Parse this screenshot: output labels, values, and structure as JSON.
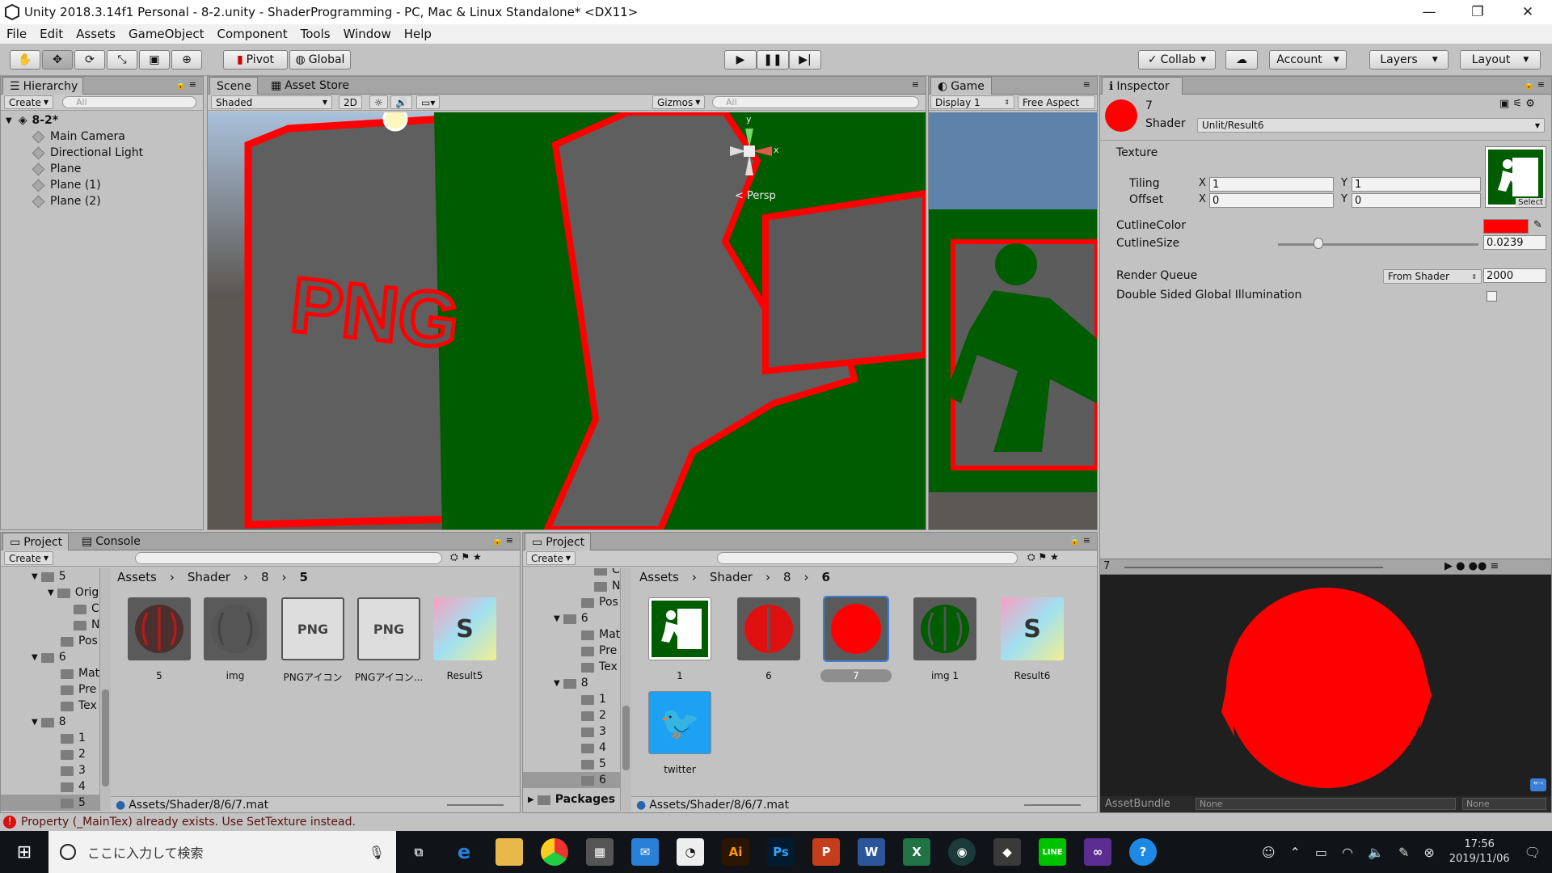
{
  "window": {
    "title": "Unity 2018.3.14f1 Personal - 8-2.unity - ShaderProgramming - PC, Mac & Linux Standalone* <DX11>"
  },
  "menu": [
    "File",
    "Edit",
    "Assets",
    "GameObject",
    "Component",
    "Tools",
    "Window",
    "Help"
  ],
  "toolbar": {
    "pivot": "Pivot",
    "global": "Global",
    "collab": "Collab",
    "account": "Account",
    "layers": "Layers",
    "layout": "Layout"
  },
  "hierarchy": {
    "tab": "Hierarchy",
    "create": "Create",
    "search_placeholder": "All",
    "scene": "8-2*",
    "items": [
      "Main Camera",
      "Directional Light",
      "Plane",
      "Plane (1)",
      "Plane (2)"
    ]
  },
  "scene": {
    "tab": "Scene",
    "tab2": "Asset Store",
    "mode": "Shaded",
    "twod": "2D",
    "gizmos": "Gizmos",
    "search_placeholder": "All",
    "persp": "Persp",
    "axis_x": "x",
    "axis_y": "y",
    "labels": {
      "png": "PNG"
    }
  },
  "game": {
    "tab": "Game",
    "display": "Display 1",
    "aspect": "Free Aspect"
  },
  "inspector": {
    "tab": "Inspector",
    "name": "7",
    "shader_label": "Shader",
    "shader_value": "Unlit/Result6",
    "texture_label": "Texture",
    "tiling_label": "Tiling",
    "offset_label": "Offset",
    "tiling_x": "1",
    "tiling_y": "1",
    "offset_x": "0",
    "offset_y": "0",
    "x": "X",
    "y": "Y",
    "select": "Select",
    "outline_color_label": "CutlineColor",
    "outline_size_label": "CutlineSize",
    "outline_size": "0.0239",
    "outline_size_fraction": 0.2,
    "render_queue_label": "Render Queue",
    "render_queue_mode": "From Shader",
    "render_queue_value": "2000",
    "dsgi_label": "Double Sided Global Illumination",
    "preview_title": "7",
    "assetbundle_label": "AssetBundle",
    "assetbundle_value": "None",
    "assetbundle_variant": "None"
  },
  "project_left": {
    "tab": "Project",
    "tab2": "Console",
    "create": "Create",
    "breadcrumb": [
      "Assets",
      "Shader",
      "8",
      "5"
    ],
    "tree": [
      {
        "label": "5"
      },
      {
        "label": "Orig"
      },
      {
        "label": "C"
      },
      {
        "label": "N"
      },
      {
        "label": "Pos"
      },
      {
        "label": "6"
      },
      {
        "label": "Mat"
      },
      {
        "label": "Pre"
      },
      {
        "label": "Tex"
      },
      {
        "label": "8"
      },
      {
        "label": "1"
      },
      {
        "label": "2"
      },
      {
        "label": "3"
      },
      {
        "label": "4"
      },
      {
        "label": "5"
      }
    ],
    "assets": [
      "5",
      "img",
      "PNGアイコン",
      "PNGアイコン...",
      "Result5"
    ],
    "path": "Assets/Shader/8/6/7.mat"
  },
  "project_right": {
    "tab": "Project",
    "create": "Create",
    "breadcrumb": [
      "Assets",
      "Shader",
      "8",
      "6"
    ],
    "tree": [
      {
        "label": "C"
      },
      {
        "label": "N"
      },
      {
        "label": "Pos"
      },
      {
        "label": "6"
      },
      {
        "label": "Mat"
      },
      {
        "label": "Pre"
      },
      {
        "label": "Tex"
      },
      {
        "label": "8"
      },
      {
        "label": "1"
      },
      {
        "label": "2"
      },
      {
        "label": "3"
      },
      {
        "label": "4"
      },
      {
        "label": "5"
      },
      {
        "label": "6"
      }
    ],
    "packages": "Packages",
    "assets": [
      "1",
      "6",
      "7",
      "img 1",
      "Result6",
      "twitter"
    ],
    "path": "Assets/Shader/8/6/7.mat"
  },
  "status": {
    "message": "Property (_MainTex) already exists. Use SetTexture instead."
  },
  "taskbar": {
    "search_placeholder": "ここに入力して検索",
    "time": "17:56",
    "date": "2019/11/06"
  },
  "colors": {
    "outline": "#ff0000",
    "green": "#005c00",
    "accent": "#3c7fd6"
  }
}
